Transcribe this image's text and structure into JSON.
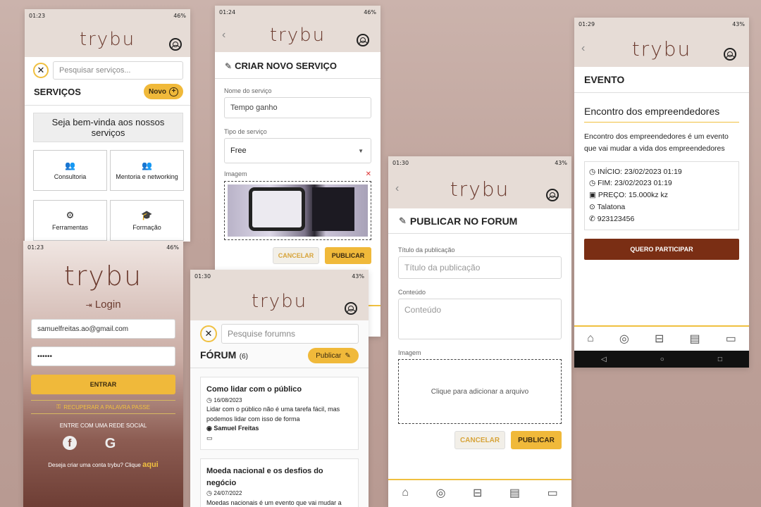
{
  "logo": "trybu",
  "p1": {
    "time": "01:23",
    "battery": "46%",
    "search_placeholder": "Pesquisar serviços...",
    "section": "SERVIÇOS",
    "new_btn": "Novo",
    "welcome": "Seja bem-vinda aos nossos serviços",
    "cards": [
      "Consultoria",
      "Mentoria e networking",
      "Ferramentas",
      "Formação"
    ]
  },
  "p2": {
    "time": "01:24",
    "battery": "46%",
    "title": "CRIAR NOVO SERVIÇO",
    "name_label": "Nome do serviço",
    "name_value": "Tempo ganho",
    "type_label": "Tipo de serviço",
    "type_value": "Free",
    "image_label": "Imagem",
    "cancel": "CANCELAR",
    "publish": "PUBLICAR"
  },
  "p3": {
    "time": "01:23",
    "battery": "46%",
    "login": "Login",
    "email": "samuelfreitas.ao@gmail.com",
    "password": "••••••",
    "enter": "ENTRAR",
    "recover": "RECUPERAR A PALAVRA PASSE",
    "social": "ENTRE COM UMA REDE SOCIAL",
    "signup": "Deseja criar uma conta trybu? Clique",
    "signup_link": "aqui"
  },
  "p4": {
    "time": "01:30",
    "battery": "43%",
    "search_placeholder": "Pesquise forumns",
    "section": "FÓRUM",
    "count": "(6)",
    "publish": "Publicar",
    "posts": [
      {
        "title": "Como lidar com o público",
        "date": "16/08/2023",
        "body": "Lidar com o público não é uma tarefa fácil, mas podemos lidar com isso de forma",
        "author": "Samuel Freitas"
      },
      {
        "title": "Moeda nacional e os desfios do negócio",
        "date": "24/07/2022",
        "body": "Moedas nacionais é um evento que vai mudar a vida dos empreendedores"
      }
    ]
  },
  "p5": {
    "time": "01:30",
    "battery": "43%",
    "title": "PUBLICAR NO FORUM",
    "title_label": "Título da publicação",
    "title_placeholder": "Título da publicação",
    "content_label": "Conteúdo",
    "content_placeholder": "Conteúdo",
    "image_label": "Imagem",
    "upload": "Clique para adicionar a arquivo",
    "cancel": "CANCELAR",
    "publish": "PUBLICAR"
  },
  "p6": {
    "time": "01:29",
    "battery": "43%",
    "section": "EVENTO",
    "title": "Encontro dos empreendedores",
    "desc": "Encontro dos empreendedores é um evento que vai mudar a vida dos empreendedores",
    "start": "INÍCIO:  23/02/2023 01:19",
    "end": "FIM:  23/02/2023 01:19",
    "price": "PREÇO:  15.000kz kz",
    "place": "Talatona",
    "phone": "923123456",
    "cta": "QUERO PARTICIPAR"
  },
  "colors": {
    "accent": "#f0b93a",
    "brand": "#6b3a2e",
    "cta": "#7a2e14"
  }
}
